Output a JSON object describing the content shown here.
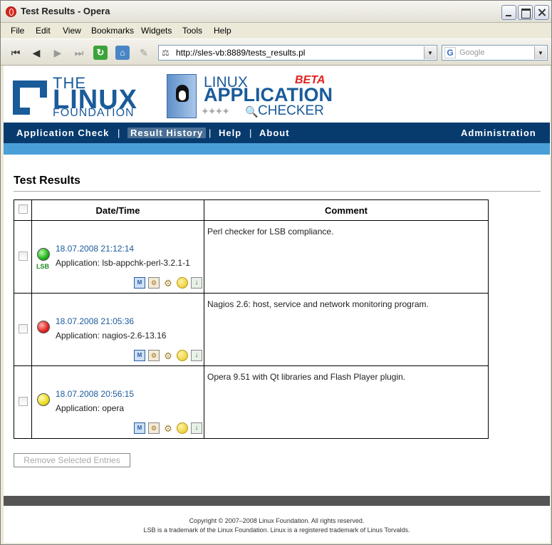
{
  "window": {
    "title": "Test Results - Opera"
  },
  "menu": [
    "File",
    "Edit",
    "View",
    "Bookmarks",
    "Widgets",
    "Tools",
    "Help"
  ],
  "address": {
    "url": "http://sles-vb:8889/tests_results.pl"
  },
  "search": {
    "placeholder": "Google"
  },
  "logos": {
    "lf_the": "THE",
    "lf_linux": "LINUX",
    "lf_foundation": "FOUNDATION",
    "app_linux": "LINUX",
    "app_application": "APPLICATION",
    "app_checker": "CHECKER",
    "app_beta": "BETA"
  },
  "nav": {
    "application_check": "Application Check",
    "result_history": "Result History",
    "help": "Help",
    "about": "About",
    "administration": "Administration",
    "separator": "|"
  },
  "page_title": "Test Results",
  "table": {
    "headers": {
      "datetime": "Date/Time",
      "comment": "Comment"
    },
    "rows": [
      {
        "date": "18.07.2008 21:12:14",
        "application": "Application: lsb-appchk-perl-3.2.1-1",
        "comment": "Perl checker for LSB compliance.",
        "status": "green",
        "badge": "LSB"
      },
      {
        "date": "18.07.2008 21:05:36",
        "application": "Application: nagios-2.6-13.16",
        "comment": "Nagios 2.6: host, service and network monitoring program.",
        "status": "red",
        "badge": ""
      },
      {
        "date": "18.07.2008 20:56:15",
        "application": "Application: opera",
        "comment": "Opera 9.51 with Qt libraries and Flash Player plugin.",
        "status": "yellow",
        "badge": ""
      }
    ]
  },
  "remove_button": "Remove Selected Entries",
  "footer": {
    "copyright": "Copyright © 2007–2008 Linux Foundation. All rights reserved.",
    "trademark": "LSB is a trademark of the Linux Foundation. Linux is a registered trademark of Linus Torvalds."
  },
  "colors": {
    "nav_bg": "#073b6e",
    "nav_accent": "#4a9fd8",
    "link": "#1c5a9c",
    "brand": "#1a5b9a"
  }
}
